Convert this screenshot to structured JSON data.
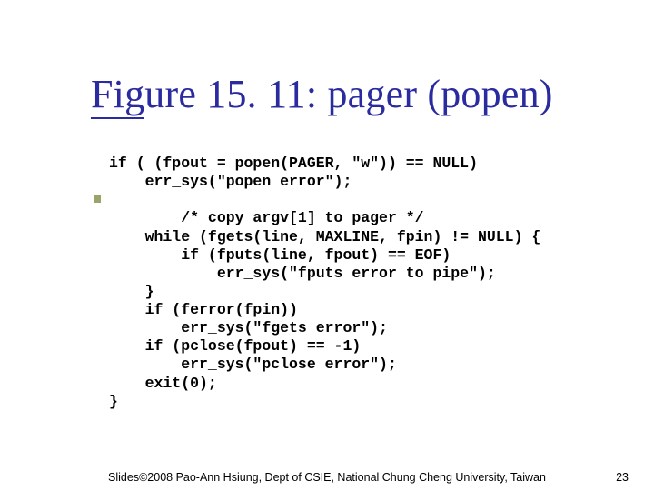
{
  "title_prefix": "Fig",
  "title_rest": "ure 15. 11: pager (popen)",
  "code": "if ( (fpout = popen(PAGER, \"w\")) == NULL)\n    err_sys(\"popen error\");\n\n        /* copy argv[1] to pager */\n    while (fgets(line, MAXLINE, fpin) != NULL) {\n        if (fputs(line, fpout) == EOF)\n            err_sys(\"fputs error to pipe\");\n    }\n    if (ferror(fpin))\n        err_sys(\"fgets error\");\n    if (pclose(fpout) == -1)\n        err_sys(\"pclose error\");\n    exit(0);\n}",
  "footer_text": "Slides©2008 Pao-Ann Hsiung, Dept of CSIE, National Chung Cheng University, Taiwan",
  "page_number": "23"
}
